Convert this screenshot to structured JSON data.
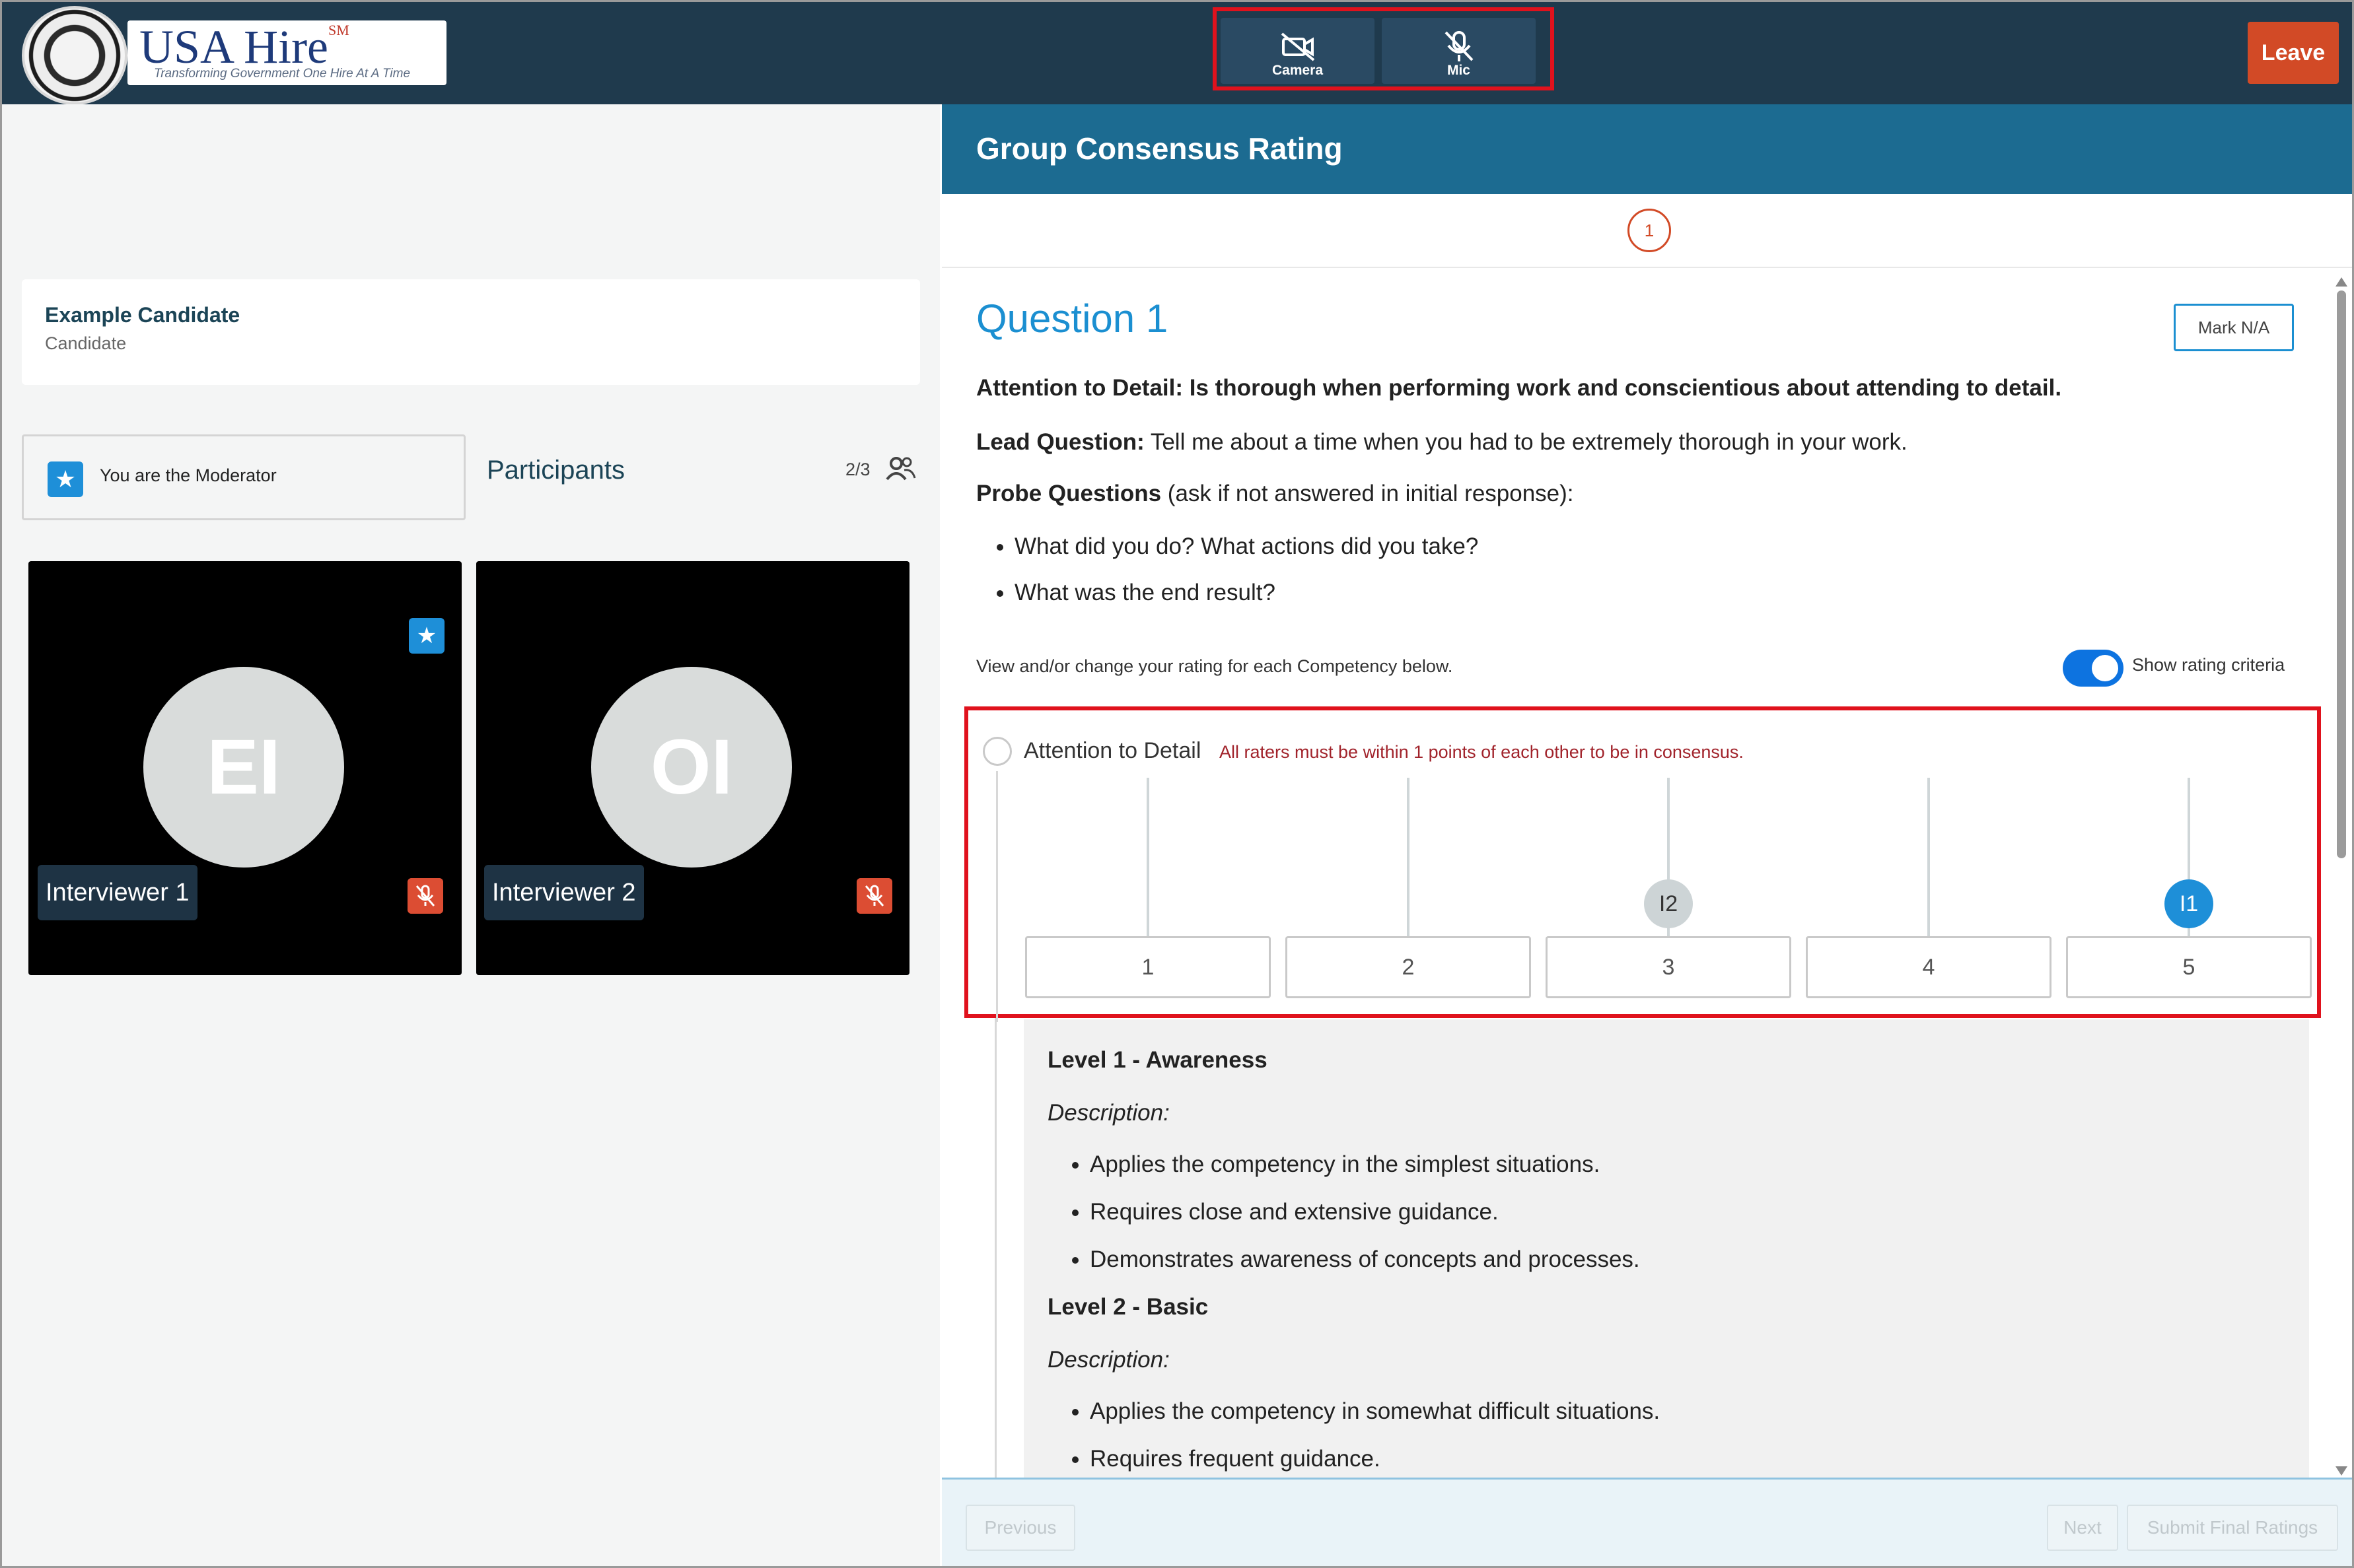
{
  "app": {
    "logo_title": "USA Hire",
    "logo_sm": "SM",
    "logo_tagline": "Transforming Government One Hire At A Time"
  },
  "toolbar": {
    "camera_label": "Camera",
    "mic_label": "Mic",
    "leave_label": "Leave"
  },
  "candidate": {
    "name": "Example Candidate",
    "role": "Candidate"
  },
  "moderator": {
    "text": "You are the Moderator"
  },
  "participants": {
    "title": "Participants",
    "count": "2/3",
    "tiles": [
      {
        "initials": "EI",
        "name": "Interviewer 1",
        "moderator": true,
        "muted": true
      },
      {
        "initials": "OI",
        "name": "Interviewer 2",
        "moderator": false,
        "muted": true
      }
    ]
  },
  "panel": {
    "title": "Group Consensus Rating",
    "step": "1"
  },
  "question": {
    "title": "Question 1",
    "mark_na": "Mark N/A",
    "competency_line": "Attention to Detail: Is thorough when performing work and conscientious about attending to detail.",
    "lead_label": "Lead Question:",
    "lead_text": " Tell me about a time when you had to be extremely thorough in your work.",
    "probe_label": "Probe Questions",
    "probe_text": " (ask if not answered in initial response):",
    "probes": [
      "What did you do? What actions did you take?",
      "What was the end result?"
    ],
    "view_text": "View and/or change your rating for each Competency below.",
    "toggle_label": "Show rating criteria",
    "toggle_on": true
  },
  "rating": {
    "competency": "Attention to Detail",
    "note": "All raters must be within 1 points of each other to be in consensus.",
    "scale": [
      "1",
      "2",
      "3",
      "4",
      "5"
    ],
    "raters": [
      {
        "label": "I2",
        "value": 3
      },
      {
        "label": "I1",
        "value": 5
      }
    ]
  },
  "criteria": {
    "description_label": "Description:",
    "levels": [
      {
        "title": "Level 1 - Awareness",
        "items": [
          "Applies the competency in the simplest situations.",
          "Requires close and extensive guidance.",
          "Demonstrates awareness of concepts and processes."
        ]
      },
      {
        "title": "Level 2 - Basic",
        "items": [
          "Applies the competency in somewhat difficult situations.",
          "Requires frequent guidance."
        ]
      }
    ]
  },
  "footer": {
    "previous": "Previous",
    "next": "Next",
    "submit": "Submit Final Ratings"
  },
  "colors": {
    "topbar": "#1f3a4d",
    "panel_header": "#1c6b91",
    "accent_blue": "#1e8fd8",
    "leave_red": "#d24a26",
    "highlight_red": "#e0121d"
  }
}
